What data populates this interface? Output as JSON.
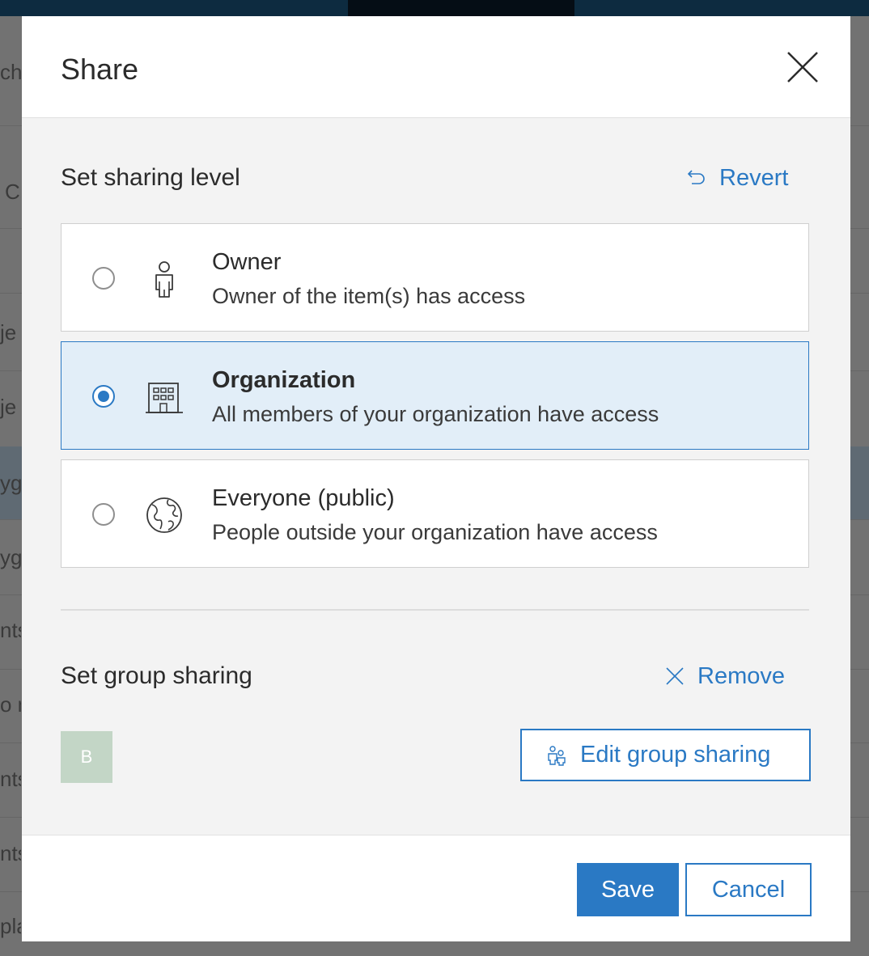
{
  "modal": {
    "title": "Share",
    "close_icon": "close-icon"
  },
  "sharing_level": {
    "title": "Set sharing level",
    "revert_label": "Revert",
    "options": [
      {
        "title": "Owner",
        "description": "Owner of the item(s) has access",
        "icon": "person-icon",
        "selected": false
      },
      {
        "title": "Organization",
        "description": "All members of your organization have access",
        "icon": "building-icon",
        "selected": true
      },
      {
        "title": "Everyone (public)",
        "description": "People outside your organization have access",
        "icon": "globe-icon",
        "selected": false
      }
    ]
  },
  "group_sharing": {
    "title": "Set group sharing",
    "remove_label": "Remove",
    "group_initial": "B",
    "edit_label": "Edit group sharing"
  },
  "footer": {
    "save_label": "Save",
    "cancel_label": "Cancel"
  },
  "background": {
    "fragments": [
      "ch",
      "C",
      "je",
      "je",
      "yg",
      "yg",
      "nts",
      "o n",
      "nts",
      "nts",
      "pla"
    ]
  },
  "colors": {
    "accent": "#2a79c4",
    "selected_bg": "#e2eef8",
    "group_tile": "#c3d6c6"
  }
}
